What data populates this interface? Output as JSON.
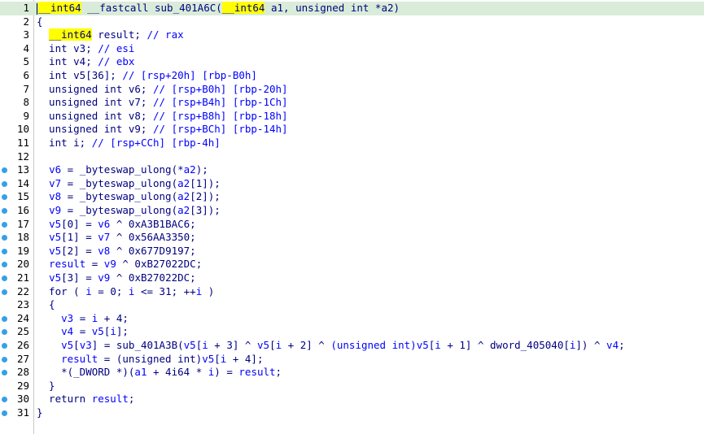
{
  "editor": {
    "lines": [
      {
        "n": "1",
        "bp": false,
        "hl": true,
        "html": [
          [
            "yb",
            "__int64"
          ],
          [
            "op",
            " __fastcall sub_401A6C("
          ],
          [
            "yb",
            "__int64"
          ],
          [
            "op",
            " a1, unsigned int *a2)"
          ]
        ]
      },
      {
        "n": "2",
        "bp": false,
        "hl": false,
        "html": [
          [
            "op",
            "{"
          ]
        ]
      },
      {
        "n": "3",
        "bp": false,
        "hl": false,
        "html": [
          [
            "op",
            "  "
          ],
          [
            "yb",
            "__int64"
          ],
          [
            "op",
            " result; "
          ],
          [
            "cm",
            "// rax"
          ]
        ]
      },
      {
        "n": "4",
        "bp": false,
        "hl": false,
        "html": [
          [
            "op",
            "  int v3; "
          ],
          [
            "cm",
            "// esi"
          ]
        ]
      },
      {
        "n": "5",
        "bp": false,
        "hl": false,
        "html": [
          [
            "op",
            "  int v4; "
          ],
          [
            "cm",
            "// ebx"
          ]
        ]
      },
      {
        "n": "6",
        "bp": false,
        "hl": false,
        "html": [
          [
            "op",
            "  int v5[36]; "
          ],
          [
            "cm",
            "// [rsp+20h] [rbp-B0h]"
          ]
        ]
      },
      {
        "n": "7",
        "bp": false,
        "hl": false,
        "html": [
          [
            "op",
            "  unsigned int v6; "
          ],
          [
            "cm",
            "// [rsp+B0h] [rbp-20h]"
          ]
        ]
      },
      {
        "n": "8",
        "bp": false,
        "hl": false,
        "html": [
          [
            "op",
            "  unsigned int v7; "
          ],
          [
            "cm",
            "// [rsp+B4h] [rbp-1Ch]"
          ]
        ]
      },
      {
        "n": "9",
        "bp": false,
        "hl": false,
        "html": [
          [
            "op",
            "  unsigned int v8; "
          ],
          [
            "cm",
            "// [rsp+B8h] [rbp-18h]"
          ]
        ]
      },
      {
        "n": "10",
        "bp": false,
        "hl": false,
        "html": [
          [
            "op",
            "  unsigned int v9; "
          ],
          [
            "cm",
            "// [rsp+BCh] [rbp-14h]"
          ]
        ]
      },
      {
        "n": "11",
        "bp": false,
        "hl": false,
        "html": [
          [
            "op",
            "  int i; "
          ],
          [
            "cm",
            "// [rsp+CCh] [rbp-4h]"
          ]
        ]
      },
      {
        "n": "12",
        "bp": false,
        "hl": false,
        "html": []
      },
      {
        "n": "13",
        "bp": true,
        "hl": false,
        "html": [
          [
            "op",
            "  "
          ],
          [
            "lv",
            "v6"
          ],
          [
            "op",
            " = _byteswap_ulong(*"
          ],
          [
            "lv",
            "a2"
          ],
          [
            "op",
            ");"
          ]
        ]
      },
      {
        "n": "14",
        "bp": true,
        "hl": false,
        "html": [
          [
            "op",
            "  "
          ],
          [
            "lv",
            "v7"
          ],
          [
            "op",
            " = _byteswap_ulong("
          ],
          [
            "lv",
            "a2"
          ],
          [
            "op",
            "[1]);"
          ]
        ]
      },
      {
        "n": "15",
        "bp": true,
        "hl": false,
        "html": [
          [
            "op",
            "  "
          ],
          [
            "lv",
            "v8"
          ],
          [
            "op",
            " = _byteswap_ulong("
          ],
          [
            "lv",
            "a2"
          ],
          [
            "op",
            "[2]);"
          ]
        ]
      },
      {
        "n": "16",
        "bp": true,
        "hl": false,
        "html": [
          [
            "op",
            "  "
          ],
          [
            "lv",
            "v9"
          ],
          [
            "op",
            " = _byteswap_ulong("
          ],
          [
            "lv",
            "a2"
          ],
          [
            "op",
            "[3]);"
          ]
        ]
      },
      {
        "n": "17",
        "bp": true,
        "hl": false,
        "html": [
          [
            "op",
            "  "
          ],
          [
            "lv",
            "v5"
          ],
          [
            "op",
            "[0] = "
          ],
          [
            "lv",
            "v6"
          ],
          [
            "op",
            " ^ 0xA3B1BAC6;"
          ]
        ]
      },
      {
        "n": "18",
        "bp": true,
        "hl": false,
        "html": [
          [
            "op",
            "  "
          ],
          [
            "lv",
            "v5"
          ],
          [
            "op",
            "[1] = "
          ],
          [
            "lv",
            "v7"
          ],
          [
            "op",
            " ^ 0x56AA3350;"
          ]
        ]
      },
      {
        "n": "19",
        "bp": true,
        "hl": false,
        "html": [
          [
            "op",
            "  "
          ],
          [
            "lv",
            "v5"
          ],
          [
            "op",
            "[2] = "
          ],
          [
            "lv",
            "v8"
          ],
          [
            "op",
            " ^ 0x677D9197;"
          ]
        ]
      },
      {
        "n": "20",
        "bp": true,
        "hl": false,
        "html": [
          [
            "op",
            "  "
          ],
          [
            "lv",
            "result"
          ],
          [
            "op",
            " = "
          ],
          [
            "lv",
            "v9"
          ],
          [
            "op",
            " ^ 0xB27022DC;"
          ]
        ]
      },
      {
        "n": "21",
        "bp": true,
        "hl": false,
        "html": [
          [
            "op",
            "  "
          ],
          [
            "lv",
            "v5"
          ],
          [
            "op",
            "[3] = "
          ],
          [
            "lv",
            "v9"
          ],
          [
            "op",
            " ^ 0xB27022DC;"
          ]
        ]
      },
      {
        "n": "22",
        "bp": true,
        "hl": false,
        "html": [
          [
            "op",
            "  for ( "
          ],
          [
            "lv",
            "i"
          ],
          [
            "op",
            " = 0; "
          ],
          [
            "lv",
            "i"
          ],
          [
            "op",
            " <= 31; ++"
          ],
          [
            "lv",
            "i"
          ],
          [
            "op",
            " )"
          ]
        ]
      },
      {
        "n": "23",
        "bp": false,
        "hl": false,
        "html": [
          [
            "op",
            "  {"
          ]
        ]
      },
      {
        "n": "24",
        "bp": true,
        "hl": false,
        "html": [
          [
            "op",
            "    "
          ],
          [
            "lv",
            "v3"
          ],
          [
            "op",
            " = "
          ],
          [
            "lv",
            "i"
          ],
          [
            "op",
            " + 4;"
          ]
        ]
      },
      {
        "n": "25",
        "bp": true,
        "hl": false,
        "html": [
          [
            "op",
            "    "
          ],
          [
            "lv",
            "v4"
          ],
          [
            "op",
            " = "
          ],
          [
            "lv",
            "v5"
          ],
          [
            "op",
            "["
          ],
          [
            "lv",
            "i"
          ],
          [
            "op",
            "];"
          ]
        ]
      },
      {
        "n": "26",
        "bp": true,
        "hl": false,
        "html": [
          [
            "op",
            "    "
          ],
          [
            "lv",
            "v5"
          ],
          [
            "op",
            "["
          ],
          [
            "lv",
            "v3"
          ],
          [
            "op",
            "] = sub_401A3B("
          ],
          [
            "lv",
            "v5"
          ],
          [
            "op",
            "["
          ],
          [
            "lv",
            "i"
          ],
          [
            "op",
            " + 3] ^ "
          ],
          [
            "lv",
            "v5"
          ],
          [
            "op",
            "["
          ],
          [
            "lv",
            "i"
          ],
          [
            "op",
            " + 2] ^ "
          ],
          [
            "lv",
            "(unsigned int)"
          ],
          [
            "lv",
            "v5"
          ],
          [
            "op",
            "["
          ],
          [
            "lv",
            "i"
          ],
          [
            "op",
            " + 1] ^ dword_405040["
          ],
          [
            "lv",
            "i"
          ],
          [
            "op",
            "]) ^ "
          ],
          [
            "lv",
            "v4"
          ],
          [
            "op",
            ";"
          ]
        ]
      },
      {
        "n": "27",
        "bp": true,
        "hl": false,
        "html": [
          [
            "op",
            "    "
          ],
          [
            "lv",
            "result"
          ],
          [
            "op",
            " = (unsigned int)"
          ],
          [
            "lv",
            "v5"
          ],
          [
            "op",
            "["
          ],
          [
            "lv",
            "i"
          ],
          [
            "op",
            " + 4];"
          ]
        ]
      },
      {
        "n": "28",
        "bp": true,
        "hl": false,
        "html": [
          [
            "op",
            "    *(_DWORD *)("
          ],
          [
            "lv",
            "a1"
          ],
          [
            "op",
            " + 4i64 * "
          ],
          [
            "lv",
            "i"
          ],
          [
            "op",
            ") = "
          ],
          [
            "lv",
            "result"
          ],
          [
            "op",
            ";"
          ]
        ]
      },
      {
        "n": "29",
        "bp": false,
        "hl": false,
        "html": [
          [
            "op",
            "  }"
          ]
        ]
      },
      {
        "n": "30",
        "bp": true,
        "hl": false,
        "html": [
          [
            "op",
            "  return "
          ],
          [
            "lv",
            "result"
          ],
          [
            "op",
            ";"
          ]
        ]
      },
      {
        "n": "31",
        "bp": true,
        "hl": false,
        "html": [
          [
            "op",
            "}"
          ]
        ]
      }
    ]
  }
}
